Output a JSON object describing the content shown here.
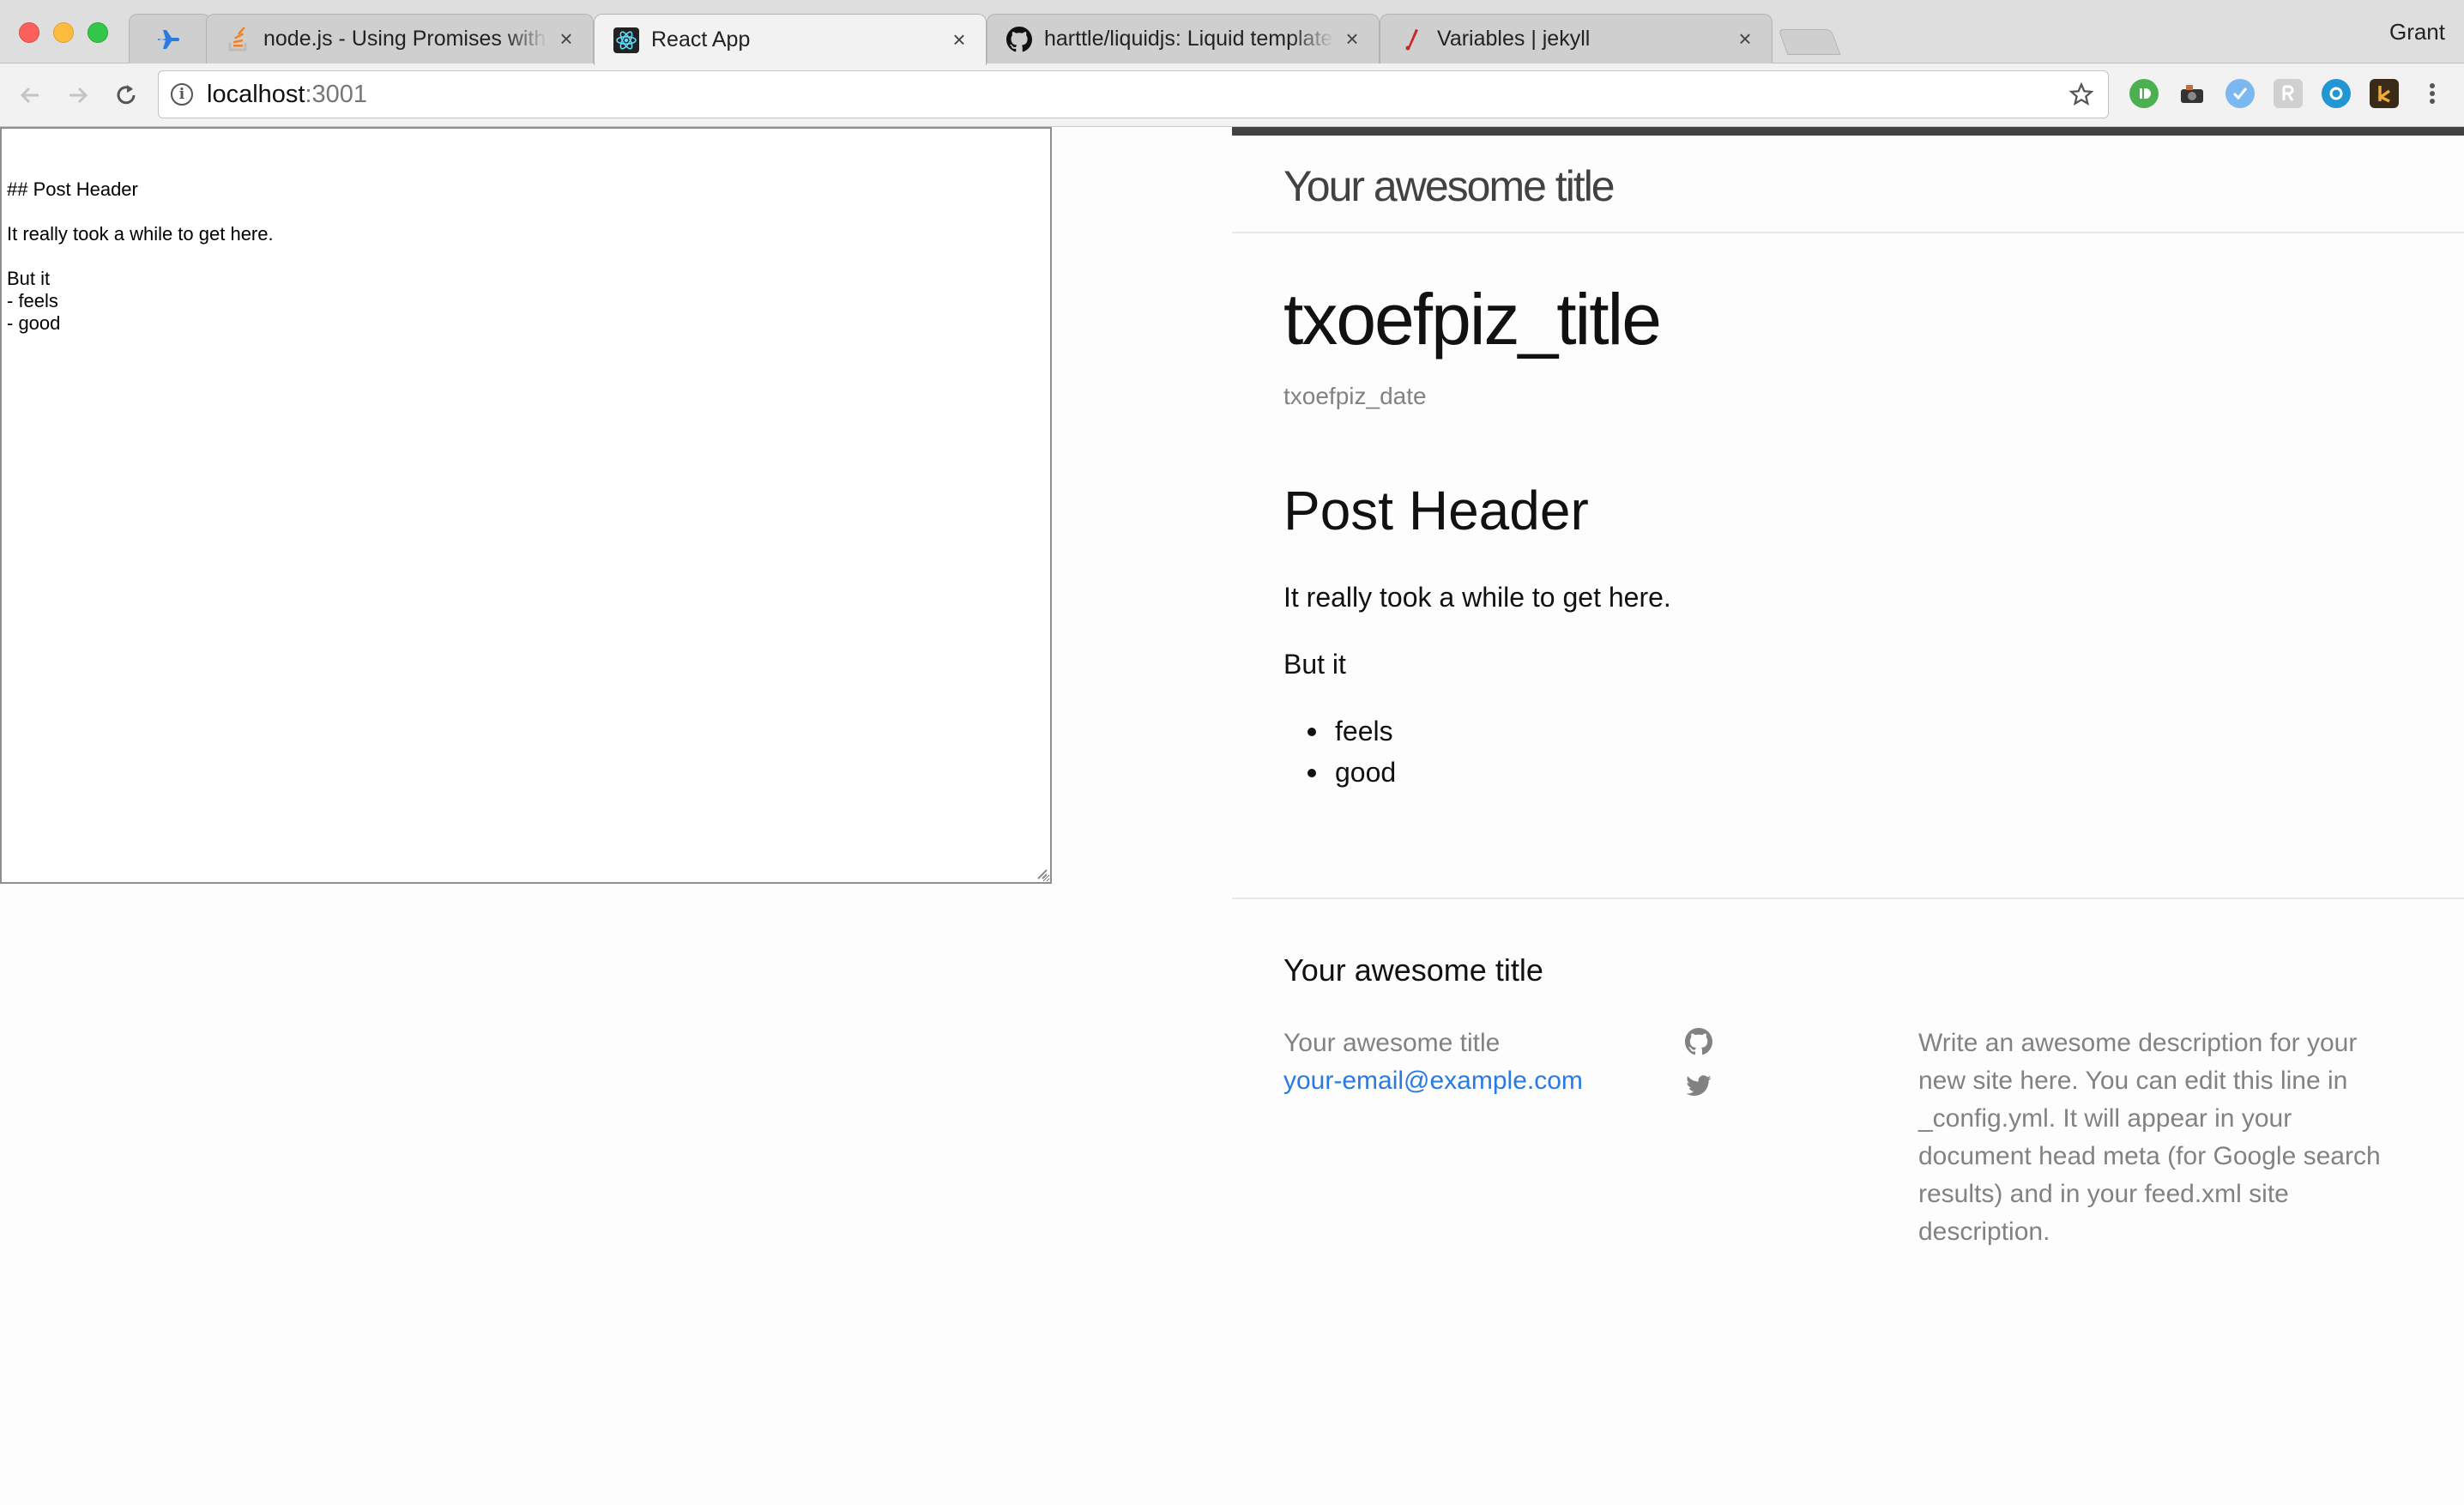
{
  "browser": {
    "tabs": [
      {
        "title": "",
        "icon": "airplane-icon",
        "active": false
      },
      {
        "title": "node.js - Using Promises with fs",
        "icon": "stackoverflow-icon",
        "active": false
      },
      {
        "title": "React App",
        "icon": "react-icon",
        "active": true
      },
      {
        "title": "harttle/liquidjs: Liquid template",
        "icon": "github-icon",
        "active": false
      },
      {
        "title": "Variables | jekyll",
        "icon": "jekyll-icon",
        "active": false
      }
    ],
    "close_glyph": "×",
    "profile_name": "Grant",
    "url_host": "localhost",
    "url_port": ":3001"
  },
  "editor": {
    "content": "## Post Header\n\nIt really took a while to get here.\n\nBut it\n- feels\n- good"
  },
  "preview": {
    "site_title": "Your awesome title",
    "post_title": "txoefpiz_title",
    "post_date": "txoefpiz_date",
    "post_header": "Post Header",
    "paragraph_1": "It really took a while to get here.",
    "paragraph_2": "But it",
    "list_items": [
      "feels",
      "good"
    ],
    "footer": {
      "heading": "Your awesome title",
      "name": "Your awesome title",
      "email": "your-email@example.com",
      "description": "Write an awesome description for your new site here. You can edit this line in _config.yml. It will appear in your document head meta (for Google search results) and in your feed.xml site description."
    }
  },
  "colors": {
    "link": "#2a7ae2",
    "header_bar": "#424242",
    "muted_text": "#828282"
  }
}
